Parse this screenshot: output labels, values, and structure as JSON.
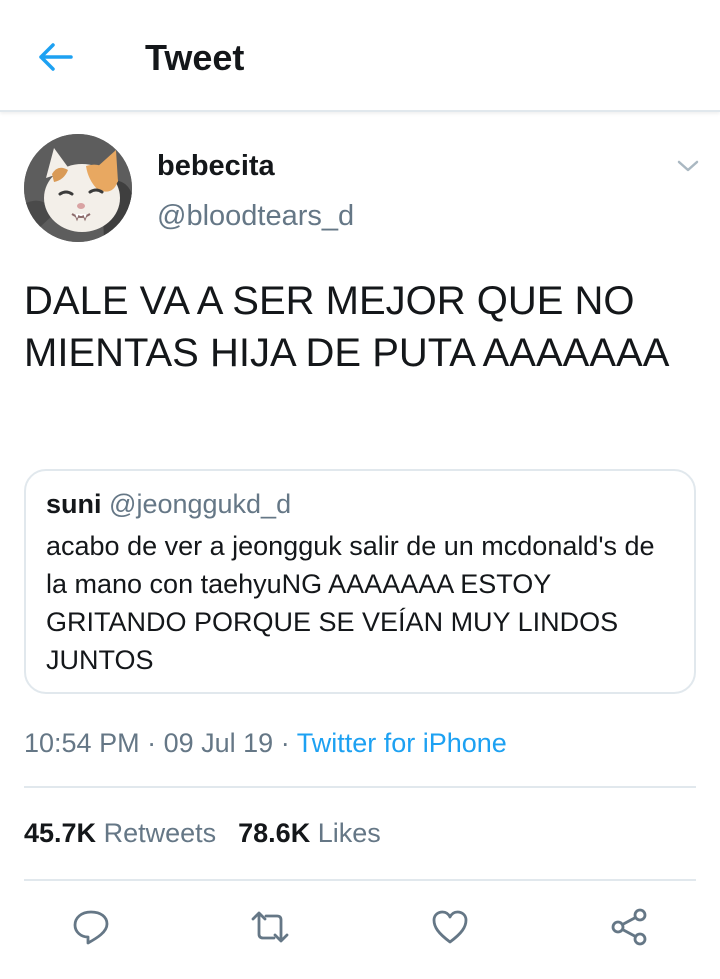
{
  "header": {
    "title": "Tweet"
  },
  "author": {
    "display_name": "bebecita",
    "handle": "@bloodtears_d"
  },
  "tweet": {
    "text": "DALE VA A SER MEJOR QUE NO MIENTAS HIJA DE PUTA AAAAAAA"
  },
  "quoted_tweet": {
    "display_name": "suni",
    "handle": "@jeonggukd_d",
    "text": "acabo de ver a jeongguk salir de un mcdonald's de la mano con taehyuNG AAAAAAA ESTOY GRITANDO PORQUE SE VEÍAN MUY LINDOS JUNTOS"
  },
  "meta": {
    "time": "10:54 PM",
    "date": "09 Jul 19",
    "separator": "·",
    "source": "Twitter for iPhone"
  },
  "stats": {
    "retweets_count": "45.7K",
    "retweets_label": "Retweets",
    "likes_count": "78.6K",
    "likes_label": "Likes"
  },
  "icons": {
    "back": "arrow-left-icon",
    "caret": "chevron-down-icon",
    "reply": "reply-icon",
    "retweet": "retweet-icon",
    "like": "heart-icon",
    "share": "share-icon"
  },
  "colors": {
    "accent": "#1da1f2",
    "secondary_text": "#657786",
    "border": "#e1e8ed",
    "icon_gray": "#657786"
  }
}
